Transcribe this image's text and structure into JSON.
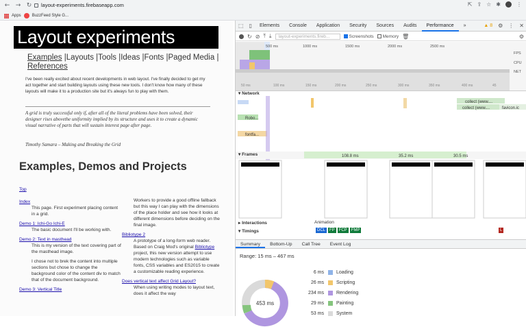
{
  "browser": {
    "url": "layout-experiments.firebaseapp.com",
    "bookmarks": [
      "Apps",
      "BuzzFeed Style G..."
    ]
  },
  "page": {
    "masthead": "Layout experiments",
    "nav": [
      "Examples",
      "|Layouts",
      "|Tools",
      "|Ideas",
      "|Fonts",
      "|Paged Media",
      "|",
      "References"
    ],
    "intro": "I've been really excited about recent developments in web layout. I've finally decided to get my act together and start building layouts using these new tools. I don't know how many of these layouts will make it to a production site but it's always fun to play with them.",
    "quote": "A grid is truly successful only if, after all of the literal problems have been solved, their designer rises abovethe uniformity implied by its structure and uses it to create a dynamic visual narrative of parts that will sustain interest page after page.",
    "attribution": "Timothy Samara – Making and Breaking the Grid",
    "heading": "Examples, Demos and Projects",
    "top_link": "Top",
    "col1": [
      {
        "link": "Index",
        "desc": "This page. First experiment placing content in a grid."
      },
      {
        "link": "Demo 1: Ichi-Go Ichi-E",
        "desc": "The basic document I'll be working with."
      },
      {
        "link": "Demo 2: Text in masthead",
        "desc": "This is my version of the text covering part of the masthead image."
      },
      {
        "link": "",
        "desc": "I chose not to brek the content into multiple sections but chose to change the background color of the content div to match that of the document background."
      },
      {
        "link": "Demo 3: Vertical Title",
        "desc": ""
      }
    ],
    "col2_lead": "Workers to provide a good offline fallback but this way I can play with the dimensions of the place holder and see how it looks at different dimensions before deciding on the final image.",
    "col2": [
      {
        "link": "Bibliotype 2",
        "desc_before": "A prototype of a long-form web reader. Based on Craig Mod's original ",
        "inline_link": "Bibliotype",
        "desc_after": " project, this new version attempt to use modern technologies such as variable fonts, CSS variables and ES2015 to create a customizable reading experience."
      },
      {
        "link": "Does vertical text affect Grid Layout?",
        "desc_before": "When using writing modes to layout text, does it affect the way",
        "inline_link": "",
        "desc_after": ""
      }
    ]
  },
  "devtools": {
    "tabs": [
      "Elements",
      "Console",
      "Application",
      "Security",
      "Sources",
      "Audits",
      "Performance",
      "»"
    ],
    "active_tab": "Performance",
    "warning_count": "8",
    "profile_select": "layout-experiments.fireb...",
    "screenshots_label": "Screenshots",
    "memory_label": "Memory",
    "overview_ticks": [
      "500 ms",
      "1000 ms",
      "1500 ms",
      "2000 ms",
      "2500 ms"
    ],
    "overview_labels": [
      "FPS",
      "CPU",
      "NET"
    ],
    "timeline_ticks": [
      "50 ms",
      "100 ms",
      "150 ms",
      "200 ms",
      "250 ms",
      "300 ms",
      "350 ms",
      "400 ms",
      "45"
    ],
    "network_label": "Network",
    "net_items": [
      "Robo...",
      "fontfa...",
      "collect (www....",
      "collect (www....",
      "favicon.ic"
    ],
    "frames_label": "Frames",
    "frame_times": [
      "108.8 ms",
      "35.2 ms",
      "30.5 ms"
    ],
    "interactions_label": "Interactions",
    "animation_label": "Animation",
    "timings_label": "Timings",
    "timing_markers": [
      "DCL",
      "FP",
      "FCP",
      "FMP",
      "L"
    ],
    "bottom_tabs": [
      "Summary",
      "Bottom-Up",
      "Call Tree",
      "Event Log"
    ],
    "range_text": "Range: 15 ms – 467 ms",
    "total": "453 ms",
    "summary": [
      {
        "value": "6 ms",
        "label": "Loading",
        "color": "#8fb3e8"
      },
      {
        "value": "26 ms",
        "label": "Scripting",
        "color": "#f2c66b"
      },
      {
        "value": "234 ms",
        "label": "Rendering",
        "color": "#af96e0"
      },
      {
        "value": "29 ms",
        "label": "Painting",
        "color": "#85c47d"
      },
      {
        "value": "53 ms",
        "label": "System",
        "color": "#dadada"
      }
    ]
  }
}
